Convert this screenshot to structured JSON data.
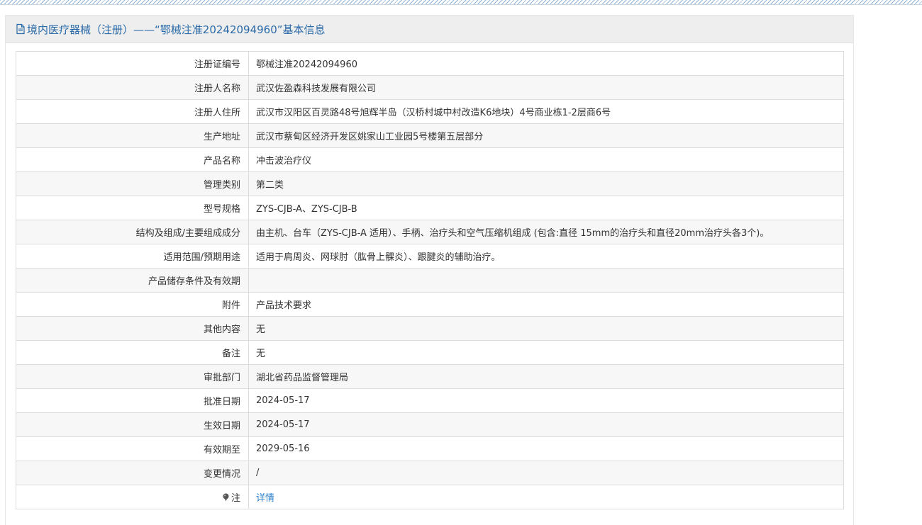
{
  "header": {
    "title": "境内医疗器械（注册）——“鄂械注准20242094960”基本信息",
    "icon": "document-icon"
  },
  "rows": [
    {
      "label": "注册证编号",
      "value": "鄂械注准20242094960"
    },
    {
      "label": "注册人名称",
      "value": "武汉佐盈森科技发展有限公司"
    },
    {
      "label": "注册人住所",
      "value": "武汉市汉阳区百灵路48号旭辉半岛（汉桥村城中村改造K6地块）4号商业栋1-2层商6号"
    },
    {
      "label": "生产地址",
      "value": "武汉市蔡甸区经济开发区姚家山工业园5号楼第五层部分"
    },
    {
      "label": "产品名称",
      "value": "冲击波治疗仪"
    },
    {
      "label": "管理类别",
      "value": "第二类"
    },
    {
      "label": "型号规格",
      "value": "ZYS-CJB-A、ZYS-CJB-B"
    },
    {
      "label": "结构及组成/主要组成成分",
      "value": "由主机、台车（ZYS-CJB-A 适用）、手柄、治疗头和空气压缩机组成 (包含:直径 15mm的治疗头和直径20mm治疗头各3个)。"
    },
    {
      "label": "适用范围/预期用途",
      "value": "适用于肩周炎、网球肘（肱骨上髁炎）、跟腱炎的辅助治疗。"
    },
    {
      "label": "产品储存条件及有效期",
      "value": ""
    },
    {
      "label": "附件",
      "value": "产品技术要求"
    },
    {
      "label": "其他内容",
      "value": "无"
    },
    {
      "label": "备注",
      "value": "无"
    },
    {
      "label": "审批部门",
      "value": "湖北省药品监督管理局"
    },
    {
      "label": "批准日期",
      "value": "2024-05-17"
    },
    {
      "label": "生效日期",
      "value": "2024-05-17"
    },
    {
      "label": "有效期至",
      "value": "2029-05-16"
    },
    {
      "label": "变更情况",
      "value": "/"
    }
  ],
  "note_row": {
    "label": "注",
    "icon": "pin-icon",
    "link_text": "详情"
  },
  "colors": {
    "header_text": "#2a6aa8",
    "link": "#2a7fce",
    "header_bg": "#eeeeee"
  }
}
